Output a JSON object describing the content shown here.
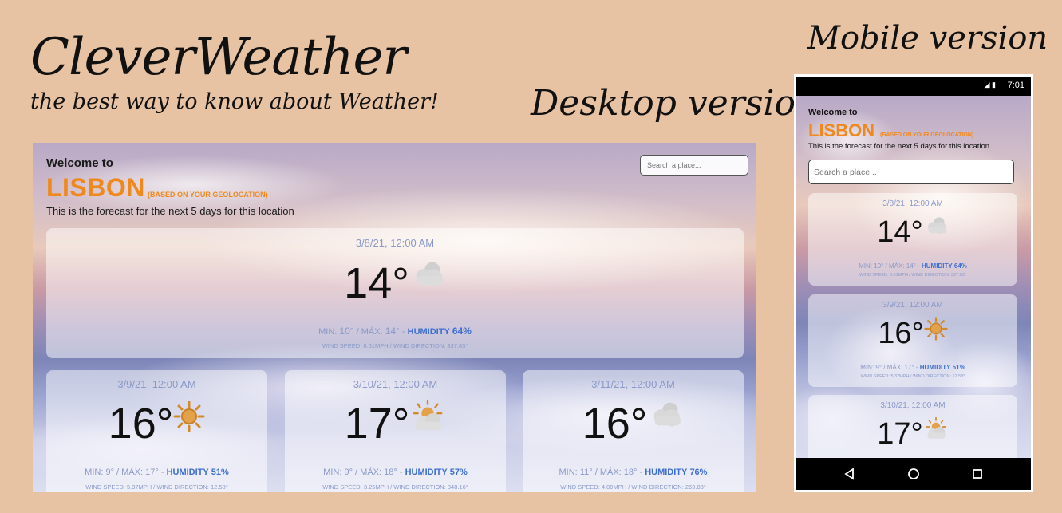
{
  "branding": {
    "title": "CleverWeather",
    "tagline": "the best way to know about Weather!",
    "desktop_label": "Desktop version",
    "mobile_label": "Mobile version"
  },
  "app": {
    "welcome": "Welcome to",
    "city": "LISBON",
    "geo_note": "(BASED ON YOUR GEOLOCATION)",
    "subtitle": "This is the forecast for the next 5 days for this location",
    "search_placeholder": "Search a place..."
  },
  "colors": {
    "accent": "#f0891d",
    "humidity": "#3f6fd0",
    "muted": "#8a99c7",
    "page_bg": "#e8c3a3"
  },
  "desktop_forecasts": [
    {
      "date": "3/8/21, 12:00 AM",
      "temp": "14°",
      "icon": "cloudy-icon",
      "min_label": "MIN:",
      "min": "10°",
      "max_label": "MÁX:",
      "max": "14°",
      "humidity_label": "HUMIDITY",
      "humidity": "64%",
      "wind": "WIND SPEED: 8.61MPH / WIND DIRECTION: 337.83°"
    },
    {
      "date": "3/9/21, 12:00 AM",
      "temp": "16°",
      "icon": "sun-icon",
      "min_label": "MIN:",
      "min": "9°",
      "max_label": "MÁX:",
      "max": "17°",
      "humidity_label": "HUMIDITY",
      "humidity": "51%",
      "wind": "WIND SPEED: 5.37MPH / WIND DIRECTION: 12.58°"
    },
    {
      "date": "3/10/21, 12:00 AM",
      "temp": "17°",
      "icon": "partly-cloudy-icon",
      "min_label": "MIN:",
      "min": "9°",
      "max_label": "MÁX:",
      "max": "18°",
      "humidity_label": "HUMIDITY",
      "humidity": "57%",
      "wind": "WIND SPEED: 3.25MPH / WIND DIRECTION: 348.16°"
    },
    {
      "date": "3/11/21, 12:00 AM",
      "temp": "16°",
      "icon": "cloudy-icon",
      "min_label": "MIN:",
      "min": "11°",
      "max_label": "MÁX:",
      "max": "18°",
      "humidity_label": "HUMIDITY",
      "humidity": "76%",
      "wind": "WIND SPEED: 4.00MPH / WIND DIRECTION: 269.83°"
    }
  ],
  "mobile": {
    "status_time": "7:01",
    "forecasts": [
      {
        "date": "3/8/21, 12:00 AM",
        "temp": "14°",
        "icon": "cloudy-icon",
        "min_label": "MIN:",
        "min": "10°",
        "max_label": "MÁX:",
        "max": "14°",
        "humidity_label": "HUMIDITY",
        "humidity": "64%",
        "wind": "WIND SPEED: 8.61MPH / WIND DIRECTION: 337.83°"
      },
      {
        "date": "3/9/21, 12:00 AM",
        "temp": "16°",
        "icon": "sun-icon",
        "min_label": "MIN:",
        "min": "9°",
        "max_label": "MÁX:",
        "max": "17°",
        "humidity_label": "HUMIDITY",
        "humidity": "51%",
        "wind": "WIND SPEED: 5.37MPH / WIND DIRECTION: 12.58°"
      },
      {
        "date": "3/10/21, 12:00 AM",
        "temp": "17°",
        "icon": "partly-cloudy-icon"
      }
    ]
  }
}
